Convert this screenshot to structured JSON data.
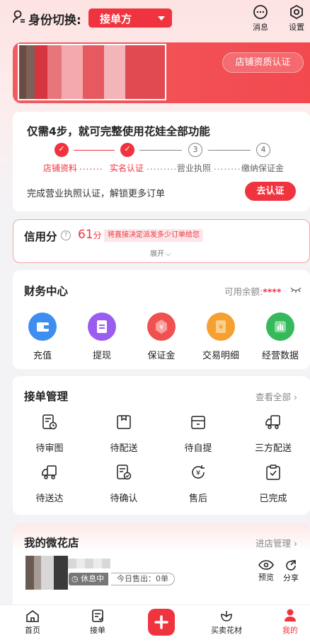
{
  "topbar": {
    "role_label": "身份切换:",
    "role_value": "接单方",
    "messages_label": "消息",
    "settings_label": "设置"
  },
  "shop": {
    "cert_button": "店铺资质认证"
  },
  "steps": {
    "title": "仅需4步，就可完整使用花娃全部功能",
    "items": [
      {
        "label": "店铺资料",
        "status": "done"
      },
      {
        "label": "实名认证",
        "status": "done"
      },
      {
        "label": "营业执照",
        "status": "todo",
        "number": "3"
      },
      {
        "label": "缴纳保证金",
        "status": "todo",
        "number": "4"
      }
    ],
    "description": "完成营业执照认证，解锁更多订单",
    "action": "去认证"
  },
  "credit": {
    "label": "信用分",
    "score": "61",
    "unit": "分",
    "tip": "将直接决定派发多少订单给您",
    "expand": "展开"
  },
  "finance": {
    "title": "财务中心",
    "balance_label": "可用余额:",
    "balance_value": "****",
    "items": [
      {
        "label": "充值",
        "icon": "wallet-icon",
        "color": "#3d8ef0"
      },
      {
        "label": "提现",
        "icon": "withdraw-icon",
        "color": "#9b5cf0"
      },
      {
        "label": "保证金",
        "icon": "deposit-icon",
        "color": "#f0504f"
      },
      {
        "label": "交易明细",
        "icon": "receipt-icon",
        "color": "#f5a030"
      },
      {
        "label": "经营数据",
        "icon": "chart-icon",
        "color": "#35b95a"
      }
    ]
  },
  "orders": {
    "title": "接单管理",
    "view_all": "查看全部",
    "items": [
      {
        "label": "待审图",
        "icon": "review-image-icon"
      },
      {
        "label": "待配送",
        "icon": "package-icon"
      },
      {
        "label": "待自提",
        "icon": "box-icon"
      },
      {
        "label": "三方配送",
        "icon": "truck-icon"
      },
      {
        "label": "待送达",
        "icon": "delivery-truck-icon"
      },
      {
        "label": "待确认",
        "icon": "confirm-doc-icon"
      },
      {
        "label": "售后",
        "icon": "yuan-refresh-icon"
      },
      {
        "label": "已完成",
        "icon": "done-clipboard-icon"
      }
    ]
  },
  "store": {
    "title": "我的微花店",
    "manage": "进店管理",
    "status": "休息中",
    "sold": "今日售出：0单",
    "preview": "预览",
    "share": "分享"
  },
  "tabbar": {
    "items": [
      {
        "label": "首页",
        "icon": "home-icon"
      },
      {
        "label": "接单",
        "icon": "order-icon"
      },
      {
        "label": "",
        "icon": "plus-icon"
      },
      {
        "label": "买卖花材",
        "icon": "flower-icon"
      },
      {
        "label": "我的",
        "icon": "profile-icon",
        "active": true
      }
    ]
  },
  "colors": {
    "accent": "#f0343f"
  }
}
